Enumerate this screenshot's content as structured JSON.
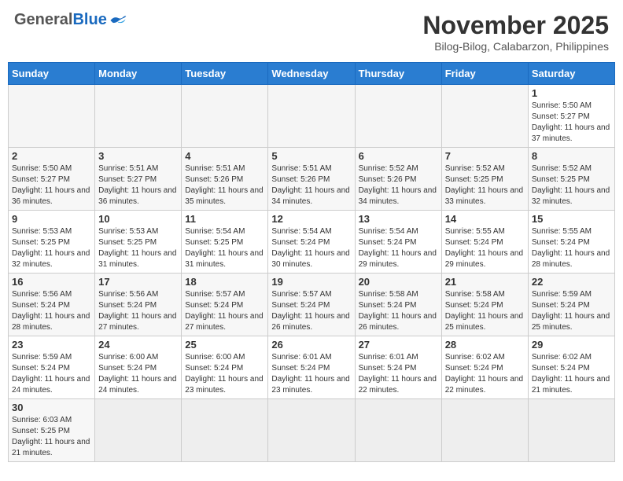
{
  "header": {
    "logo": {
      "general": "General",
      "blue": "Blue"
    },
    "title": "November 2025",
    "location": "Bilog-Bilog, Calabarzon, Philippines"
  },
  "calendar": {
    "weekdays": [
      "Sunday",
      "Monday",
      "Tuesday",
      "Wednesday",
      "Thursday",
      "Friday",
      "Saturday"
    ],
    "weeks": [
      [
        {
          "day": null,
          "sunrise": null,
          "sunset": null,
          "daylight": null
        },
        {
          "day": null,
          "sunrise": null,
          "sunset": null,
          "daylight": null
        },
        {
          "day": null,
          "sunrise": null,
          "sunset": null,
          "daylight": null
        },
        {
          "day": null,
          "sunrise": null,
          "sunset": null,
          "daylight": null
        },
        {
          "day": null,
          "sunrise": null,
          "sunset": null,
          "daylight": null
        },
        {
          "day": null,
          "sunrise": null,
          "sunset": null,
          "daylight": null
        },
        {
          "day": "1",
          "sunrise": "5:50 AM",
          "sunset": "5:27 PM",
          "daylight": "11 hours and 37 minutes."
        }
      ],
      [
        {
          "day": "2",
          "sunrise": "5:50 AM",
          "sunset": "5:27 PM",
          "daylight": "11 hours and 36 minutes."
        },
        {
          "day": "3",
          "sunrise": "5:51 AM",
          "sunset": "5:27 PM",
          "daylight": "11 hours and 36 minutes."
        },
        {
          "day": "4",
          "sunrise": "5:51 AM",
          "sunset": "5:26 PM",
          "daylight": "11 hours and 35 minutes."
        },
        {
          "day": "5",
          "sunrise": "5:51 AM",
          "sunset": "5:26 PM",
          "daylight": "11 hours and 34 minutes."
        },
        {
          "day": "6",
          "sunrise": "5:52 AM",
          "sunset": "5:26 PM",
          "daylight": "11 hours and 34 minutes."
        },
        {
          "day": "7",
          "sunrise": "5:52 AM",
          "sunset": "5:25 PM",
          "daylight": "11 hours and 33 minutes."
        },
        {
          "day": "8",
          "sunrise": "5:52 AM",
          "sunset": "5:25 PM",
          "daylight": "11 hours and 32 minutes."
        }
      ],
      [
        {
          "day": "9",
          "sunrise": "5:53 AM",
          "sunset": "5:25 PM",
          "daylight": "11 hours and 32 minutes."
        },
        {
          "day": "10",
          "sunrise": "5:53 AM",
          "sunset": "5:25 PM",
          "daylight": "11 hours and 31 minutes."
        },
        {
          "day": "11",
          "sunrise": "5:54 AM",
          "sunset": "5:25 PM",
          "daylight": "11 hours and 31 minutes."
        },
        {
          "day": "12",
          "sunrise": "5:54 AM",
          "sunset": "5:24 PM",
          "daylight": "11 hours and 30 minutes."
        },
        {
          "day": "13",
          "sunrise": "5:54 AM",
          "sunset": "5:24 PM",
          "daylight": "11 hours and 29 minutes."
        },
        {
          "day": "14",
          "sunrise": "5:55 AM",
          "sunset": "5:24 PM",
          "daylight": "11 hours and 29 minutes."
        },
        {
          "day": "15",
          "sunrise": "5:55 AM",
          "sunset": "5:24 PM",
          "daylight": "11 hours and 28 minutes."
        }
      ],
      [
        {
          "day": "16",
          "sunrise": "5:56 AM",
          "sunset": "5:24 PM",
          "daylight": "11 hours and 28 minutes."
        },
        {
          "day": "17",
          "sunrise": "5:56 AM",
          "sunset": "5:24 PM",
          "daylight": "11 hours and 27 minutes."
        },
        {
          "day": "18",
          "sunrise": "5:57 AM",
          "sunset": "5:24 PM",
          "daylight": "11 hours and 27 minutes."
        },
        {
          "day": "19",
          "sunrise": "5:57 AM",
          "sunset": "5:24 PM",
          "daylight": "11 hours and 26 minutes."
        },
        {
          "day": "20",
          "sunrise": "5:58 AM",
          "sunset": "5:24 PM",
          "daylight": "11 hours and 26 minutes."
        },
        {
          "day": "21",
          "sunrise": "5:58 AM",
          "sunset": "5:24 PM",
          "daylight": "11 hours and 25 minutes."
        },
        {
          "day": "22",
          "sunrise": "5:59 AM",
          "sunset": "5:24 PM",
          "daylight": "11 hours and 25 minutes."
        }
      ],
      [
        {
          "day": "23",
          "sunrise": "5:59 AM",
          "sunset": "5:24 PM",
          "daylight": "11 hours and 24 minutes."
        },
        {
          "day": "24",
          "sunrise": "6:00 AM",
          "sunset": "5:24 PM",
          "daylight": "11 hours and 24 minutes."
        },
        {
          "day": "25",
          "sunrise": "6:00 AM",
          "sunset": "5:24 PM",
          "daylight": "11 hours and 23 minutes."
        },
        {
          "day": "26",
          "sunrise": "6:01 AM",
          "sunset": "5:24 PM",
          "daylight": "11 hours and 23 minutes."
        },
        {
          "day": "27",
          "sunrise": "6:01 AM",
          "sunset": "5:24 PM",
          "daylight": "11 hours and 22 minutes."
        },
        {
          "day": "28",
          "sunrise": "6:02 AM",
          "sunset": "5:24 PM",
          "daylight": "11 hours and 22 minutes."
        },
        {
          "day": "29",
          "sunrise": "6:02 AM",
          "sunset": "5:24 PM",
          "daylight": "11 hours and 21 minutes."
        }
      ],
      [
        {
          "day": "30",
          "sunrise": "6:03 AM",
          "sunset": "5:25 PM",
          "daylight": "11 hours and 21 minutes."
        },
        {
          "day": null,
          "sunrise": null,
          "sunset": null,
          "daylight": null
        },
        {
          "day": null,
          "sunrise": null,
          "sunset": null,
          "daylight": null
        },
        {
          "day": null,
          "sunrise": null,
          "sunset": null,
          "daylight": null
        },
        {
          "day": null,
          "sunrise": null,
          "sunset": null,
          "daylight": null
        },
        {
          "day": null,
          "sunrise": null,
          "sunset": null,
          "daylight": null
        },
        {
          "day": null,
          "sunrise": null,
          "sunset": null,
          "daylight": null
        }
      ]
    ]
  }
}
